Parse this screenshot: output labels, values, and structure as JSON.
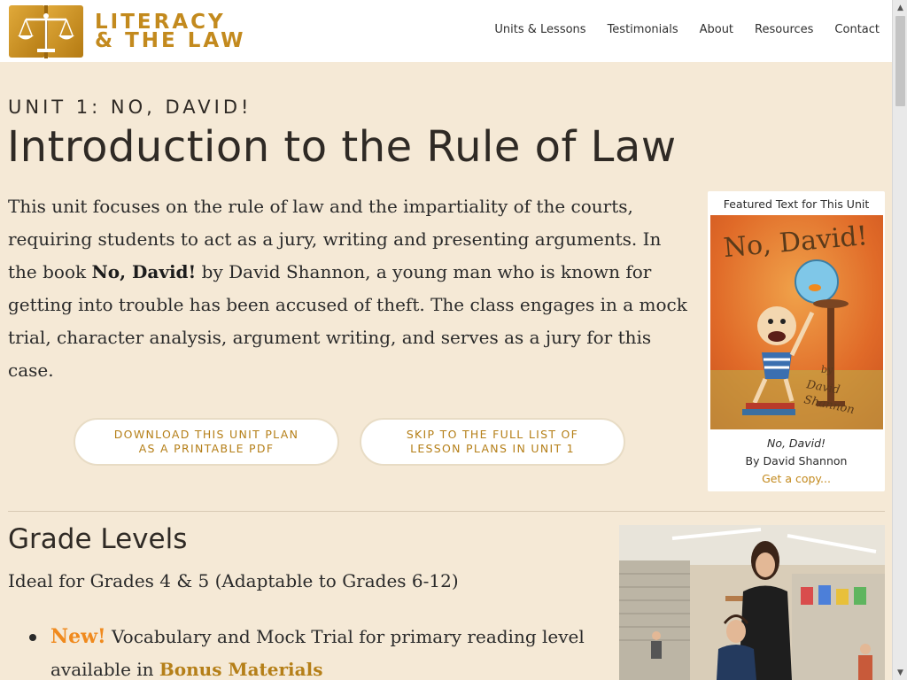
{
  "brand": {
    "line1": "LITERACY",
    "line2": "& THE LAW"
  },
  "nav": [
    "Units & Lessons",
    "Testimonials",
    "About",
    "Resources",
    "Contact"
  ],
  "hero": {
    "unit_label": "UNIT 1: NO, DAVID!",
    "title": "Introduction to the Rule of Law",
    "intro_before": "This unit focuses on the rule of law and the impartiality of the courts, requiring students to act as a jury, writing and presenting arguments. In the book ",
    "intro_book": "No, David!",
    "intro_after": " by David Shannon, a young man who is known for getting into trouble has been accused of theft. The class engages in a mock trial, character analysis, argument writing, and serves as a jury for this case."
  },
  "buttons": {
    "pdf_line1": "DOWNLOAD THIS UNIT PLAN",
    "pdf_line2": "AS A PRINTABLE PDF",
    "skip_line1": "SKIP TO THE FULL LIST OF",
    "skip_line2": "LESSON PLANS IN UNIT 1"
  },
  "featured": {
    "heading": "Featured Text for This Unit",
    "cover_title": "No, David!",
    "cover_by": "by",
    "cover_author_1": "David",
    "cover_author_2": "Shannon",
    "book_title": "No, David!",
    "book_author": "By David Shannon",
    "book_link": "Get a copy..."
  },
  "grade": {
    "title": "Grade Levels",
    "ideal": "Ideal for Grades 4 & 5 (Adaptable to Grades 6-12)",
    "bullet_new": "New!",
    "bullet_text": " Vocabulary and Mock Trial for primary reading level available in ",
    "bullet_link": "Bonus Materials"
  },
  "colors": {
    "page_bg": "#f5e9d6",
    "brand_gold": "#c38a1e",
    "new_orange": "#f08a1e",
    "header_bg": "#ffffff"
  },
  "icons": {
    "logo": "book-scales-icon",
    "scroll_up": "triangle-up-icon",
    "scroll_down": "triangle-down-icon"
  }
}
